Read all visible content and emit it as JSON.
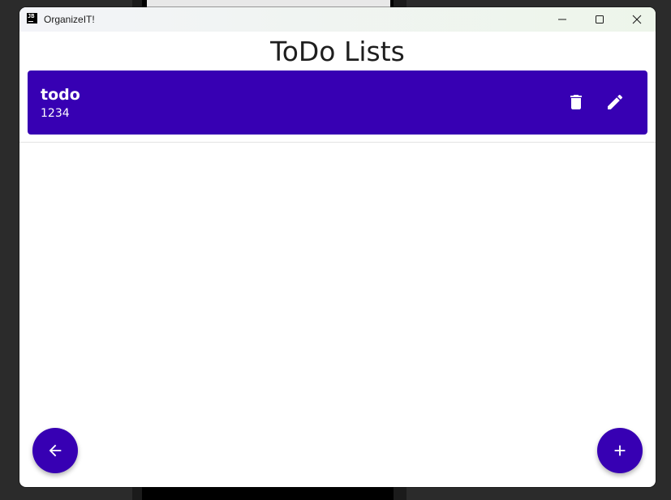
{
  "window": {
    "title": "OrganizeIT!",
    "icon_text": "JB"
  },
  "page": {
    "title": "ToDo Lists"
  },
  "lists": [
    {
      "name": "todo",
      "subtitle": "1234"
    }
  ],
  "icons": {
    "app": "jetbrains-icon",
    "minimize": "minimize-icon",
    "maximize": "maximize-icon",
    "close": "close-icon",
    "delete": "trash-icon",
    "edit": "pencil-icon",
    "back": "arrow-left-icon",
    "add": "plus-icon"
  },
  "colors": {
    "primary": "#3700b3",
    "on_primary": "#ffffff",
    "background": "#ffffff"
  }
}
